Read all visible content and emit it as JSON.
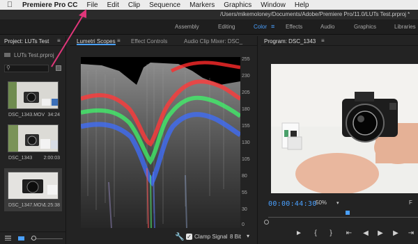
{
  "menubar": {
    "app_name": "Premiere Pro CC",
    "items": [
      "File",
      "Edit",
      "Clip",
      "Sequence",
      "Markers",
      "Graphics",
      "Window",
      "Help"
    ]
  },
  "title_path": "/Users/mikemoloney/Documents/Adobe/Premiere Pro/11.0/LUTs Test.prproj *",
  "workspaces": {
    "items": [
      "Assembly",
      "Editing",
      "Color",
      "Effects",
      "Audio",
      "Graphics",
      "Libraries"
    ],
    "active": "Color"
  },
  "project": {
    "tab_label": "Project: LUTs Test",
    "file_name": "LUTs Test.prproj",
    "clips": [
      {
        "name": "DSC_1343.MOV",
        "duration": "34:24"
      },
      {
        "name": "DSC_1343",
        "duration": "2:00:03"
      },
      {
        "name": "DSC_1347.MOV",
        "duration": "1:25:38"
      }
    ]
  },
  "scopes": {
    "tabs": [
      "Lumetri Scopes",
      "Effect Controls",
      "Audio Clip Mixer: DSC_"
    ],
    "scale_labels": [
      "255",
      "230",
      "205",
      "180",
      "155",
      "130",
      "105",
      "80",
      "55",
      "30",
      "0"
    ],
    "clamp_label": "Clamp Signal",
    "clamp_checked": true,
    "bit_depth": "8 Bit"
  },
  "program": {
    "tab_label": "Program: DSC_1343",
    "timecode": "00:00:44:30",
    "zoom": "50%",
    "fit": "F",
    "playhead_position": 0.53
  },
  "colors": {
    "accent": "#4aa0ff",
    "panel_bg": "#232323"
  }
}
